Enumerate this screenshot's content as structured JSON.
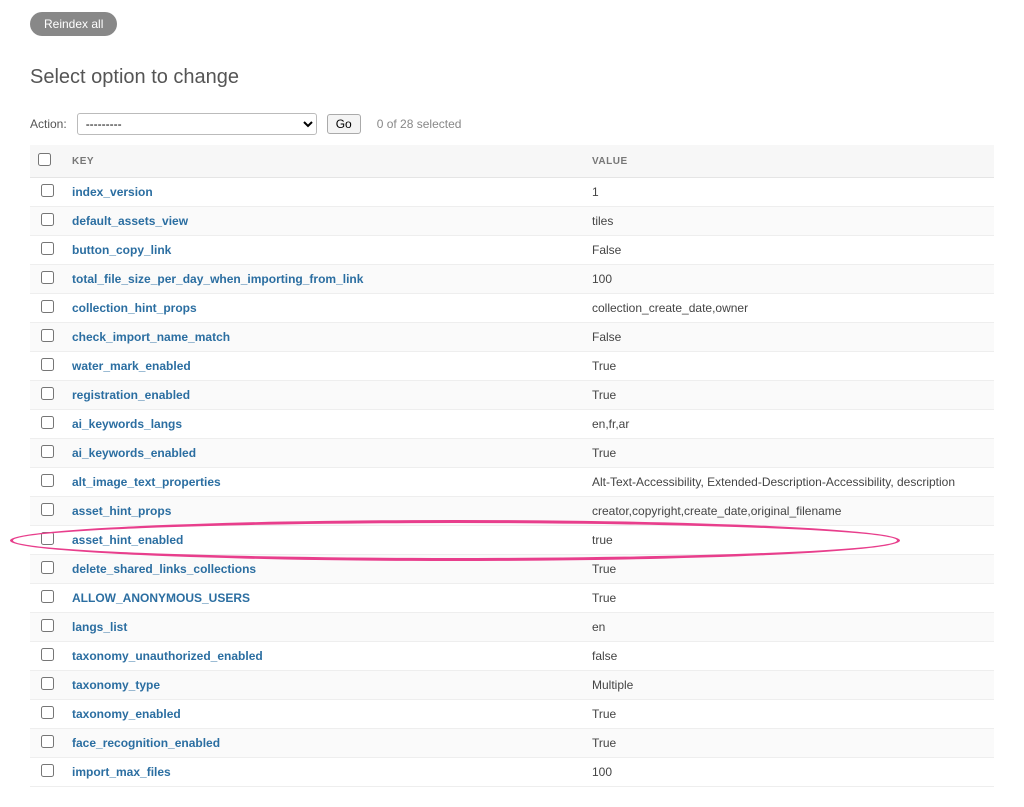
{
  "toolbar": {
    "reindex_label": "Reindex all"
  },
  "heading": "Select option to change",
  "actions": {
    "label": "Action:",
    "placeholder": "---------",
    "go_label": "Go",
    "selection_count": "0 of 28 selected"
  },
  "columns": {
    "key": "KEY",
    "value": "VALUE"
  },
  "rows": [
    {
      "key": "index_version",
      "value": "1"
    },
    {
      "key": "default_assets_view",
      "value": "tiles"
    },
    {
      "key": "button_copy_link",
      "value": "False"
    },
    {
      "key": "total_file_size_per_day_when_importing_from_link",
      "value": "100"
    },
    {
      "key": "collection_hint_props",
      "value": "collection_create_date,owner"
    },
    {
      "key": "check_import_name_match",
      "value": "False"
    },
    {
      "key": "water_mark_enabled",
      "value": "True"
    },
    {
      "key": "registration_enabled",
      "value": "True"
    },
    {
      "key": "ai_keywords_langs",
      "value": "en,fr,ar"
    },
    {
      "key": "ai_keywords_enabled",
      "value": "True"
    },
    {
      "key": "alt_image_text_properties",
      "value": "Alt-Text-Accessibility, Extended-Description-Accessibility, description"
    },
    {
      "key": "asset_hint_props",
      "value": "creator,copyright,create_date,original_filename"
    },
    {
      "key": "asset_hint_enabled",
      "value": "true",
      "highlight": true
    },
    {
      "key": "delete_shared_links_collections",
      "value": "True"
    },
    {
      "key": "ALLOW_ANONYMOUS_USERS",
      "value": "True"
    },
    {
      "key": "langs_list",
      "value": "en"
    },
    {
      "key": "taxonomy_unauthorized_enabled",
      "value": "false"
    },
    {
      "key": "taxonomy_type",
      "value": "Multiple"
    },
    {
      "key": "taxonomy_enabled",
      "value": "True"
    },
    {
      "key": "face_recognition_enabled",
      "value": "True"
    },
    {
      "key": "import_max_files",
      "value": "100"
    }
  ]
}
